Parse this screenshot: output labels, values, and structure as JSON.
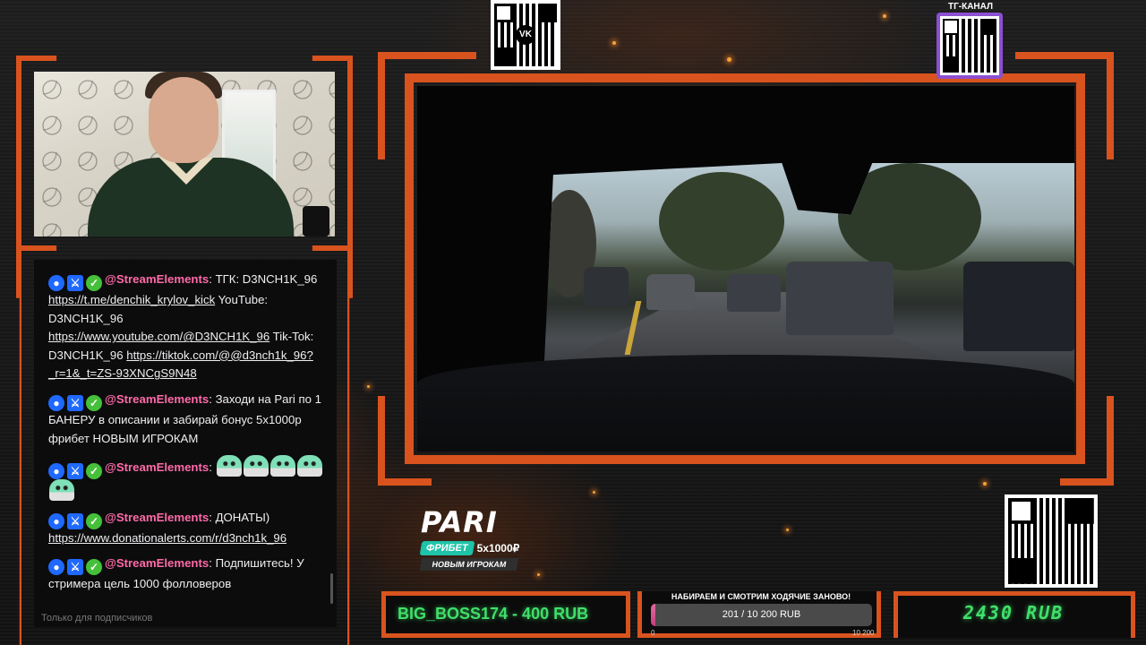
{
  "chat": {
    "messages": [
      {
        "author": "@StreamElements",
        "sep": ":",
        "parts": [
          "ТГК: D3NCH1K_96 ",
          "https://t.me/denchik_krylov_kick",
          " YouTube: D3NCH1K_96 ",
          "https://www.youtube.com/@D3NCH1K_96",
          " Tik-Tok: D3NCH1K_96 ",
          "https://tiktok.com/@@d3nch1k_96?_r=1&_t=ZS-93XNCgS9N48"
        ]
      },
      {
        "author": "@StreamElements",
        "sep": ":",
        "text": "Заходи на Pari по 1 БАНЕРУ в описании и забирай бонус 5х1000р фрибет НОВЫМ ИГРОКАМ"
      },
      {
        "author": "@StreamElements",
        "sep": ":"
      },
      {
        "author": "@StreamElements",
        "sep": ":",
        "text": "ДОНАТЫ)",
        "link": "https://www.donationalerts.com/r/d3nch1k_96"
      },
      {
        "author": "@StreamElements",
        "sep": ":",
        "text": "Подпишитесь! У стримера цель 1000 фолловеров"
      }
    ],
    "input_hint": "Только для подписчиков"
  },
  "qr_top": {
    "center": "VK"
  },
  "tg": {
    "label": "ТГ-КАНАЛ"
  },
  "pari": {
    "logo": "PARI",
    "freebet": "ФРИБЕТ",
    "amount": "5x1000₽",
    "subtitle": "НОВЫМ ИГРОКАМ"
  },
  "donor": {
    "text": "BIG_BOSS174 - 400 RUB"
  },
  "goal": {
    "title": "НАБИРАЕМ И СМОТРИМ ХОДЯЧИЕ ЗАНОВО!",
    "progress_text": "201 / 10 200 RUB",
    "current": 201,
    "target": 10200,
    "min_label": "0",
    "max_label": "10 200"
  },
  "total": {
    "text": "2430  RUB"
  },
  "colors": {
    "frame": "#d9531e",
    "accent_green": "#40e06a",
    "author": "#ff6aa8"
  }
}
